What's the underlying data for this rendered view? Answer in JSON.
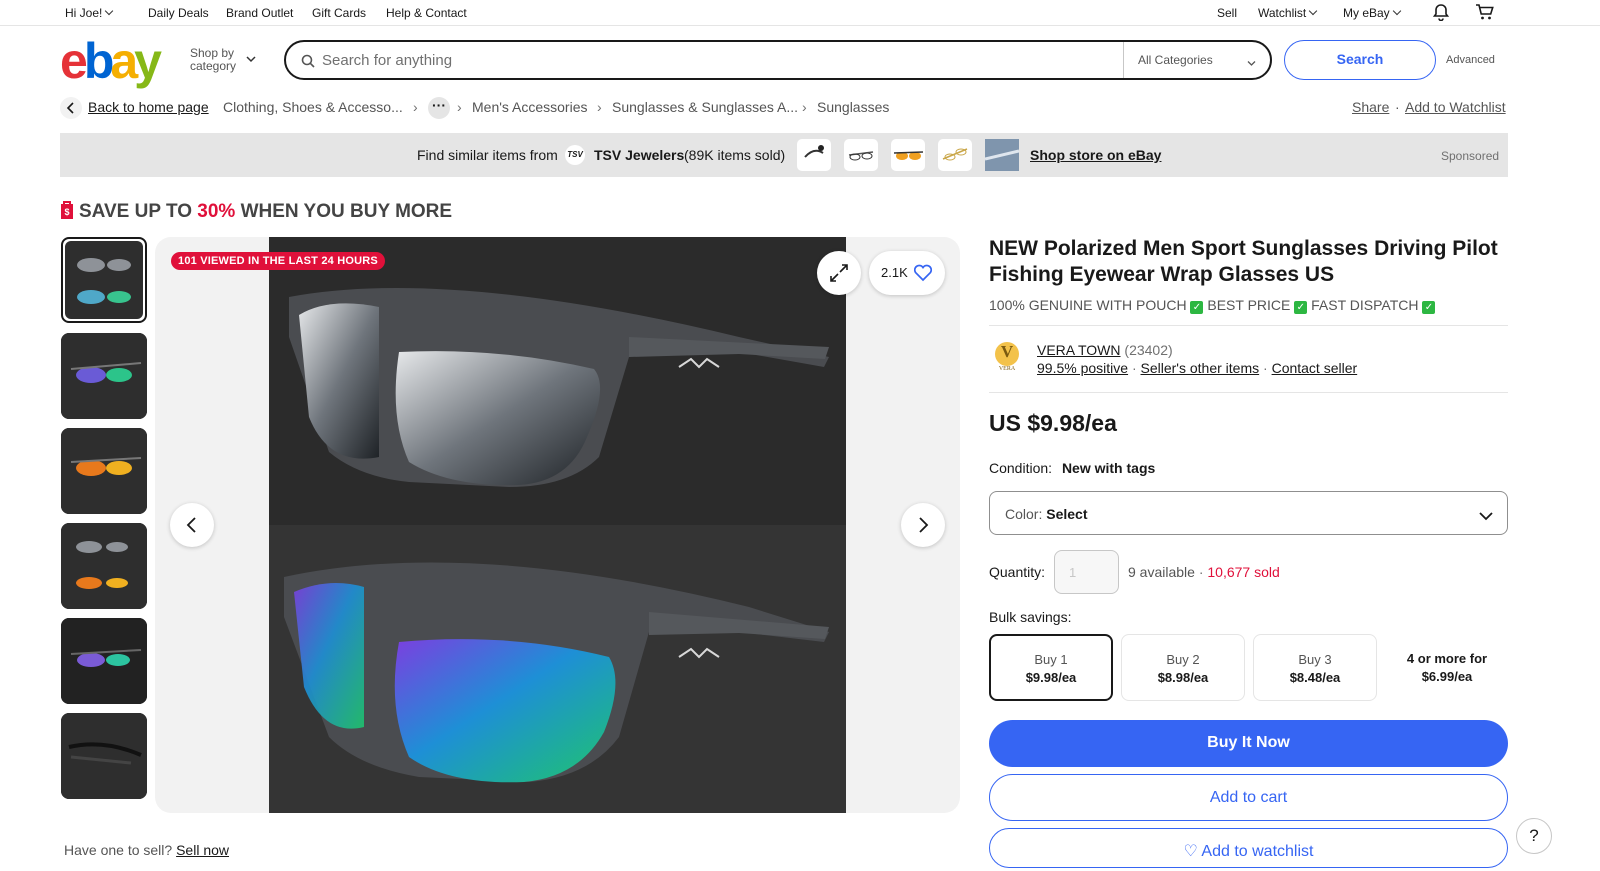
{
  "topnav": {
    "greeting": "Hi Joe!",
    "links": [
      "Daily Deals",
      "Brand Outlet",
      "Gift Cards",
      "Help & Contact"
    ],
    "sell": "Sell",
    "watchlist": "Watchlist",
    "myebay": "My eBay"
  },
  "header": {
    "logo_letters": [
      "e",
      "b",
      "a",
      "y"
    ],
    "logo_colors": [
      "#e53238",
      "#0064d2",
      "#f5af02",
      "#86b817"
    ],
    "shop_by_line1": "Shop by",
    "shop_by_line2": "category",
    "search_placeholder": "Search for anything",
    "category": "All Categories",
    "search_button": "Search",
    "advanced": "Advanced"
  },
  "breadcrumb": {
    "back": "Back to home page",
    "items": [
      "Clothing, Shoes & Accesso...",
      "Men's Accessories",
      "Sunglasses & Sunglasses A...",
      "Sunglasses"
    ],
    "share": "Share",
    "add_watchlist": "Add to Watchlist"
  },
  "sponsored": {
    "find_similar": "Find similar items from",
    "store_logo": "TSV",
    "store": "TSV Jewelers",
    "sold": "(89K items sold)",
    "shop_store": "Shop store on eBay",
    "sponsored": "Sponsored"
  },
  "promo": {
    "pre": "SAVE UP TO",
    "pct": "30%",
    "post": "WHEN YOU BUY MORE"
  },
  "gallery": {
    "viewed_badge": "101 VIEWED IN THE LAST 24 HOURS",
    "likes": "2.1K"
  },
  "product": {
    "title": "NEW Polarized Men Sport Sunglasses Driving Pilot Fishing Eyewear Wrap Glasses US",
    "subtitle_parts": [
      "100% GENUINE WITH POUCH",
      "BEST PRICE",
      "FAST DISPATCH"
    ],
    "check_glyph": "✓",
    "seller_logo_letter": "V",
    "seller_logo_word": "VERA",
    "seller_name": "VERA TOWN",
    "seller_score": "(23402)",
    "positive": "99.5% positive",
    "other_items": "Seller's other items",
    "contact": "Contact seller",
    "price": "US $9.98/ea",
    "condition_label": "Condition:",
    "condition": "New with tags",
    "color_label": "Color:",
    "color_value": "Select",
    "quantity_label": "Quantity:",
    "quantity_value": "1",
    "available": "9 available",
    "sold": "10,677 sold",
    "bulk_label": "Bulk savings:",
    "bulk": [
      {
        "qty": "Buy 1",
        "price": "$9.98/ea"
      },
      {
        "qty": "Buy 2",
        "price": "$8.98/ea"
      },
      {
        "qty": "Buy 3",
        "price": "$8.48/ea"
      },
      {
        "qty": "4 or more for",
        "price": "$6.99/ea"
      }
    ],
    "buy_now": "Buy It Now",
    "add_cart": "Add to cart",
    "add_watch": "♡ Add to watchlist"
  },
  "footer": {
    "have_one": "Have one to sell?",
    "sell_now": "Sell now",
    "help": "?"
  }
}
